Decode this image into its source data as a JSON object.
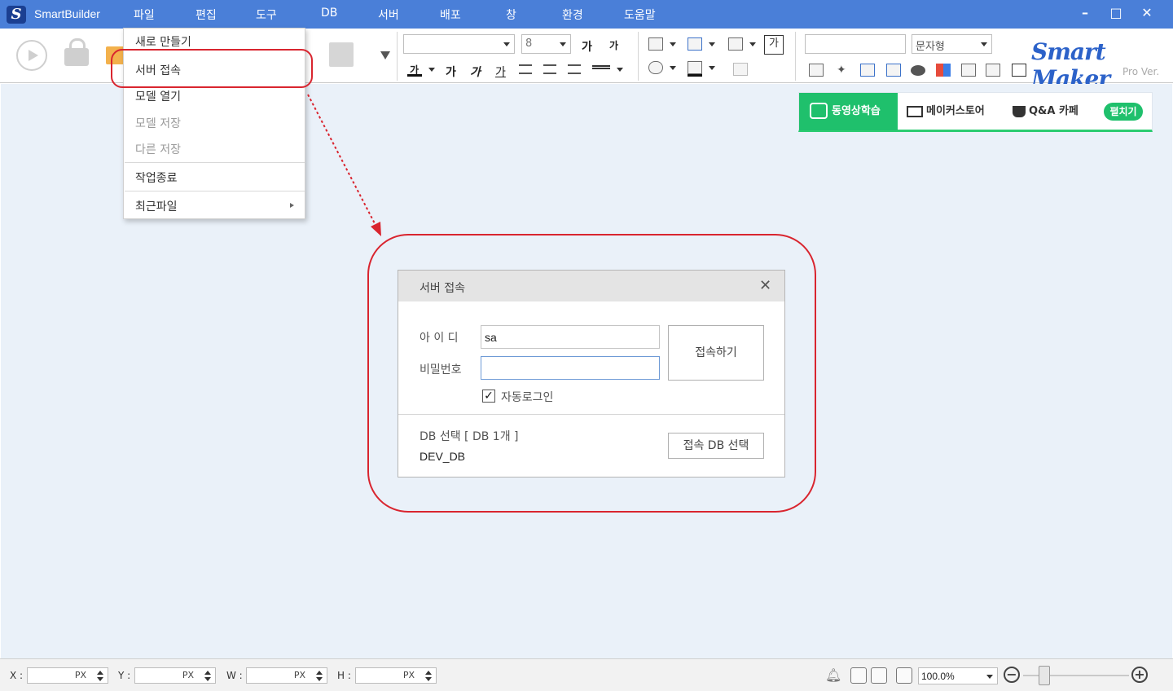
{
  "app": {
    "title": "SmartBuilder",
    "logo_glyph": "S"
  },
  "menu": [
    "파일",
    "편집",
    "도구",
    "DB",
    "서버",
    "배포",
    "창",
    "환경",
    "도움말"
  ],
  "window_controls": {
    "minimize": "–",
    "maximize": "□",
    "close": "✕"
  },
  "toolbar": {
    "font_size": "8",
    "type_select": "문자형",
    "glyph_ga": "가",
    "brand": "Smart Maker",
    "brand_sub": "Pro Ver."
  },
  "promo": {
    "items": [
      "동영상학습",
      "메이커스토어",
      "Q&A 카페"
    ],
    "toggle": "펼치기"
  },
  "file_menu": {
    "items": [
      {
        "label": "새로 만들기",
        "disabled": false
      },
      {
        "label": "서버 접속",
        "disabled": false
      },
      {
        "label": "모델 열기",
        "disabled": false
      },
      {
        "label": "모델 저장",
        "disabled": true
      },
      {
        "label": "다른 저장",
        "disabled": true
      },
      {
        "label": "작업종료",
        "disabled": false
      },
      {
        "label": "최근파일",
        "disabled": false
      }
    ]
  },
  "dialog": {
    "title": "서버 접속",
    "close": "✕",
    "id_label": "아 이 디",
    "id_value": "sa",
    "pw_label": "비밀번호",
    "pw_value": "",
    "connect_button": "접속하기",
    "auto_login": "자동로그인",
    "auto_login_checked": true,
    "checkmark": "✓",
    "db_select_label": "DB 선택 [ DB 1개 ]",
    "db_name": "DEV_DB",
    "db_select_button": "접속 DB 선택"
  },
  "statusbar": {
    "fields": [
      {
        "label": "X :",
        "unit": "PX"
      },
      {
        "label": "Y :",
        "unit": "PX"
      },
      {
        "label": "W :",
        "unit": "PX"
      },
      {
        "label": "H :",
        "unit": "PX"
      }
    ],
    "zoom": "100.0%",
    "zoom_minus": "−",
    "zoom_plus": "+"
  },
  "colors": {
    "titlebar": "#4a7fd8",
    "workspace": "#eaf1f9",
    "highlight": "#d9252f",
    "promo_green": "#1fc06c",
    "brand_blue": "#2c62c9"
  }
}
